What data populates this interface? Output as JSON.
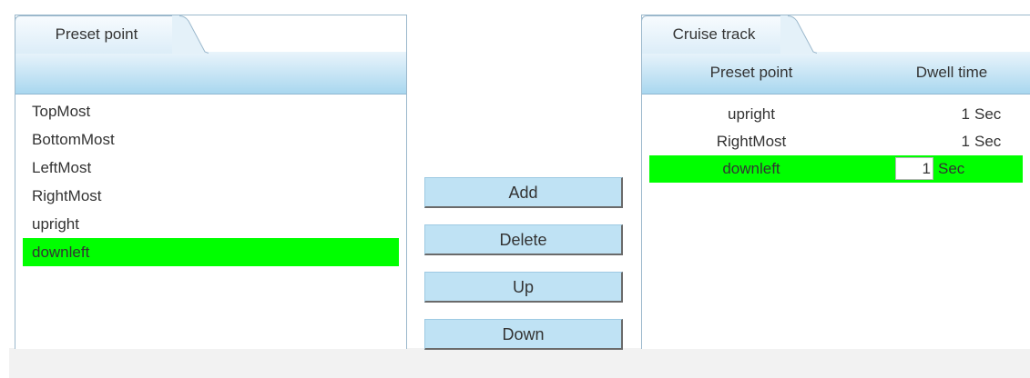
{
  "preset_panel": {
    "tab_label": "Preset point",
    "items": [
      {
        "label": "TopMost",
        "selected": false
      },
      {
        "label": "BottomMost",
        "selected": false
      },
      {
        "label": "LeftMost",
        "selected": false
      },
      {
        "label": "RightMost",
        "selected": false
      },
      {
        "label": "upright",
        "selected": false
      },
      {
        "label": "downleft",
        "selected": true
      }
    ]
  },
  "buttons": {
    "add": "Add",
    "delete": "Delete",
    "up": "Up",
    "down": "Down"
  },
  "cruise_panel": {
    "tab_label": "Cruise track",
    "col_preset": "Preset point",
    "col_dwell": "Dwell time",
    "unit": "Sec",
    "rows": [
      {
        "preset": "upright",
        "dwell": "1",
        "selected": false
      },
      {
        "preset": "RightMost",
        "dwell": "1",
        "selected": false
      },
      {
        "preset": "downleft",
        "dwell": "1",
        "selected": true
      }
    ]
  },
  "colors": {
    "selection": "#00ff00",
    "header_gradient_top": "#e9f4fb",
    "header_gradient_bottom": "#a9d7ef",
    "button_fill": "#bfe2f4"
  }
}
